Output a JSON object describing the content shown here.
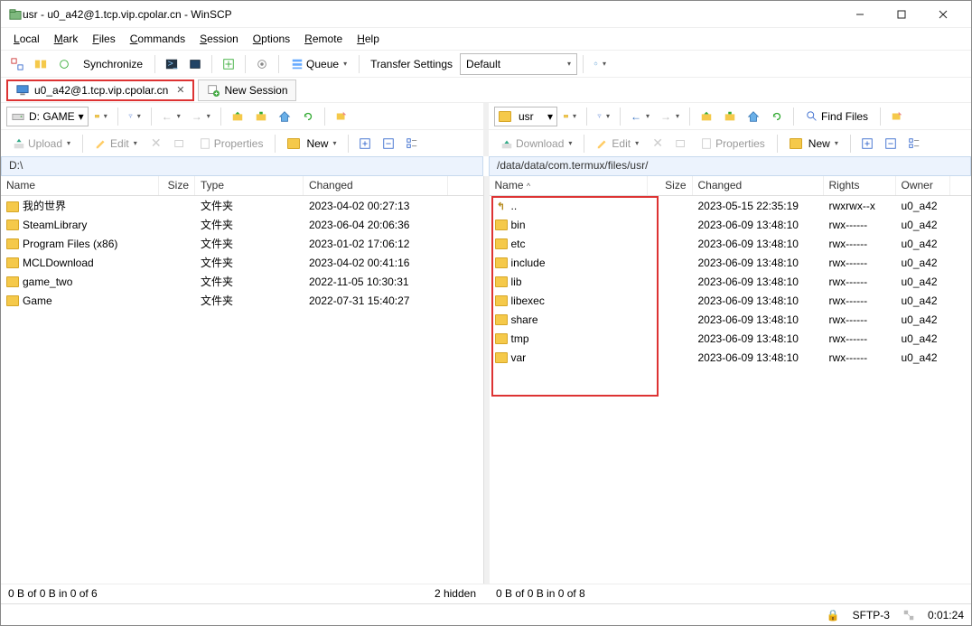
{
  "window": {
    "title": "usr - u0_a42@1.tcp.vip.cpolar.cn - WinSCP"
  },
  "menu": [
    "Local",
    "Mark",
    "Files",
    "Commands",
    "Session",
    "Options",
    "Remote",
    "Help"
  ],
  "toolbar1": {
    "synchronize": "Synchronize",
    "queue": "Queue",
    "transfer_label": "Transfer Settings",
    "transfer_value": "Default"
  },
  "session": {
    "active_tab": "u0_a42@1.tcp.vip.cpolar.cn",
    "new_session": "New Session"
  },
  "nav": {
    "left_drive": "D: GAME",
    "right_drive": "usr",
    "find_files": "Find Files"
  },
  "actions": {
    "upload": "Upload",
    "download": "Download",
    "edit": "Edit",
    "properties": "Properties",
    "new": "New"
  },
  "paths": {
    "left": "D:\\",
    "right": "/data/data/com.termux/files/usr/"
  },
  "left_headers": {
    "name": "Name",
    "size": "Size",
    "type": "Type",
    "changed": "Changed"
  },
  "right_headers": {
    "name": "Name",
    "size": "Size",
    "changed": "Changed",
    "rights": "Rights",
    "owner": "Owner"
  },
  "left_files": [
    {
      "name": "我的世界",
      "type": "文件夹",
      "changed": "2023-04-02  00:27:13"
    },
    {
      "name": "SteamLibrary",
      "type": "文件夹",
      "changed": "2023-06-04  20:06:36"
    },
    {
      "name": "Program Files (x86)",
      "type": "文件夹",
      "changed": "2023-01-02  17:06:12"
    },
    {
      "name": "MCLDownload",
      "type": "文件夹",
      "changed": "2023-04-02  00:41:16"
    },
    {
      "name": "game_two",
      "type": "文件夹",
      "changed": "2022-11-05  10:30:31"
    },
    {
      "name": "Game",
      "type": "文件夹",
      "changed": "2022-07-31  15:40:27"
    }
  ],
  "right_files": [
    {
      "name": "..",
      "up": true,
      "changed": "2023-05-15 22:35:19",
      "rights": "rwxrwx--x",
      "owner": "u0_a42"
    },
    {
      "name": "bin",
      "changed": "2023-06-09 13:48:10",
      "rights": "rwx------",
      "owner": "u0_a42"
    },
    {
      "name": "etc",
      "changed": "2023-06-09 13:48:10",
      "rights": "rwx------",
      "owner": "u0_a42"
    },
    {
      "name": "include",
      "changed": "2023-06-09 13:48:10",
      "rights": "rwx------",
      "owner": "u0_a42"
    },
    {
      "name": "lib",
      "changed": "2023-06-09 13:48:10",
      "rights": "rwx------",
      "owner": "u0_a42"
    },
    {
      "name": "libexec",
      "changed": "2023-06-09 13:48:10",
      "rights": "rwx------",
      "owner": "u0_a42"
    },
    {
      "name": "share",
      "changed": "2023-06-09 13:48:10",
      "rights": "rwx------",
      "owner": "u0_a42"
    },
    {
      "name": "tmp",
      "changed": "2023-06-09 13:48:10",
      "rights": "rwx------",
      "owner": "u0_a42"
    },
    {
      "name": "var",
      "changed": "2023-06-09 13:48:10",
      "rights": "rwx------",
      "owner": "u0_a42"
    }
  ],
  "footer": {
    "left_status": "0 B of 0 B in 0 of 6",
    "left_hidden": "2 hidden",
    "right_status": "0 B of 0 B in 0 of 8"
  },
  "statusbar": {
    "protocol": "SFTP-3",
    "time": "0:01:24"
  }
}
